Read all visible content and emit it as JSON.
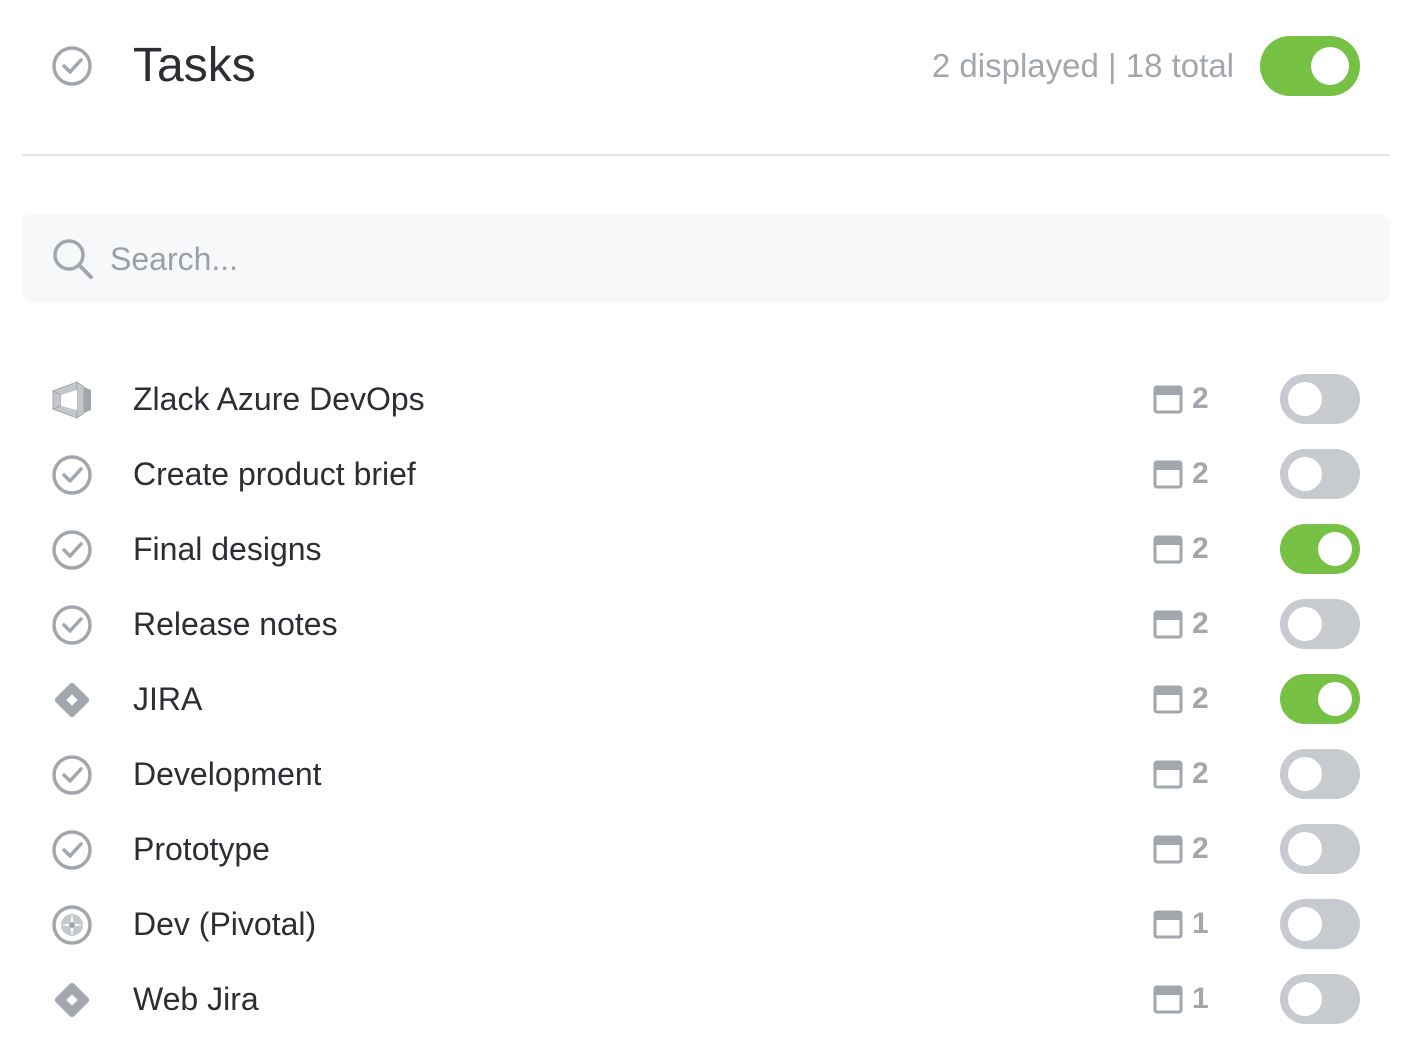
{
  "header": {
    "title": "Tasks",
    "count_text": "2 displayed | 18 total",
    "toggle_on": true
  },
  "search": {
    "placeholder": "Search..."
  },
  "colors": {
    "toggle_on": "#76c043",
    "toggle_off": "#c7cbd0",
    "icon_gray": "#a2a7ad"
  },
  "tasks": [
    {
      "name": "Zlack Azure DevOps",
      "icon": "azure-devops-icon",
      "count": "2",
      "enabled": false
    },
    {
      "name": "Create product brief",
      "icon": "check-circle-icon",
      "count": "2",
      "enabled": false
    },
    {
      "name": "Final designs",
      "icon": "check-circle-icon",
      "count": "2",
      "enabled": true
    },
    {
      "name": "Release notes",
      "icon": "check-circle-icon",
      "count": "2",
      "enabled": false
    },
    {
      "name": "JIRA",
      "icon": "jira-icon",
      "count": "2",
      "enabled": true
    },
    {
      "name": "Development",
      "icon": "check-circle-icon",
      "count": "2",
      "enabled": false
    },
    {
      "name": "Prototype",
      "icon": "check-circle-icon",
      "count": "2",
      "enabled": false
    },
    {
      "name": "Dev (Pivotal)",
      "icon": "pivotal-icon",
      "count": "1",
      "enabled": false
    },
    {
      "name": "Web Jira",
      "icon": "jira-icon",
      "count": "1",
      "enabled": false
    }
  ]
}
